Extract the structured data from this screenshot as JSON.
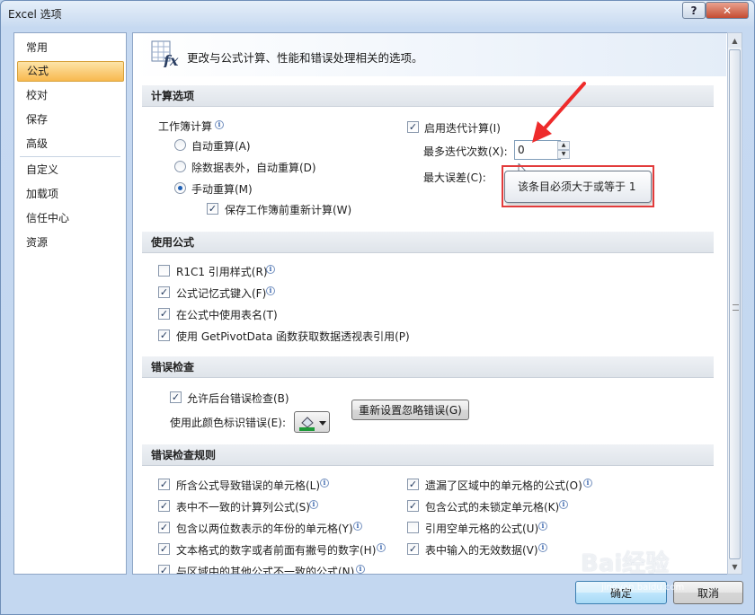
{
  "window": {
    "title": "Excel 选项",
    "help_label": "?",
    "close_label": "✕"
  },
  "sidebar": {
    "items": [
      {
        "label": "常用"
      },
      {
        "label": "公式"
      },
      {
        "label": "校对"
      },
      {
        "label": "保存"
      },
      {
        "label": "高级"
      },
      {
        "label": "自定义"
      },
      {
        "label": "加载项"
      },
      {
        "label": "信任中心"
      },
      {
        "label": "资源"
      }
    ],
    "active": "公式"
  },
  "header": {
    "text": "更改与公式计算、性能和错误处理相关的选项。",
    "icon": "fx-icon"
  },
  "calc": {
    "section": "计算选项",
    "workbook_label": "工作簿计算",
    "auto": "自动重算(A)",
    "auto_except": "除数据表外，自动重算(D)",
    "manual": "手动重算(M)",
    "recalc_before_save": "保存工作簿前重新计算(W)",
    "enable_iter": "启用迭代计算(I)",
    "max_iter_label": "最多迭代次数(X):",
    "max_iter_value": "0",
    "max_change_label": "最大误差(C):",
    "tooltip": "该条目必须大于或等于 1"
  },
  "formulas": {
    "section": "使用公式",
    "r1c1": "R1C1 引用样式(R)",
    "autocomplete": "公式记忆式键入(F)",
    "table_names": "在公式中使用表名(T)",
    "getpivot": "使用 GetPivotData 函数获取数据透视表引用(P)"
  },
  "errcheck": {
    "section": "错误检查",
    "enable_bg": "允许后台错误检查(B)",
    "color_label": "使用此颜色标识错误(E):",
    "reset_button": "重新设置忽略错误(G)",
    "color_value": "#1f9a3a"
  },
  "rules": {
    "section": "错误检查规则",
    "left": [
      {
        "label": "所含公式导致错误的单元格(L)",
        "checked": true
      },
      {
        "label": "表中不一致的计算列公式(S)",
        "checked": true
      },
      {
        "label": "包含以两位数表示的年份的单元格(Y)",
        "checked": true
      },
      {
        "label": "文本格式的数字或者前面有撇号的数字(H)",
        "checked": true
      },
      {
        "label": "与区域中的其他公式不一致的公式(N)",
        "checked": true
      }
    ],
    "right": [
      {
        "label": "遗漏了区域中的单元格的公式(O)",
        "checked": true
      },
      {
        "label": "包含公式的未锁定单元格(K)",
        "checked": true
      },
      {
        "label": "引用空单元格的公式(U)",
        "checked": false
      },
      {
        "label": "表中输入的无效数据(V)",
        "checked": true
      }
    ]
  },
  "footer": {
    "ok": "确定",
    "cancel": "取消"
  },
  "watermark": {
    "text": "Bai经验",
    "sub": "jingyan.baidu.com"
  },
  "check_mark": "✓",
  "info_glyph": "i"
}
